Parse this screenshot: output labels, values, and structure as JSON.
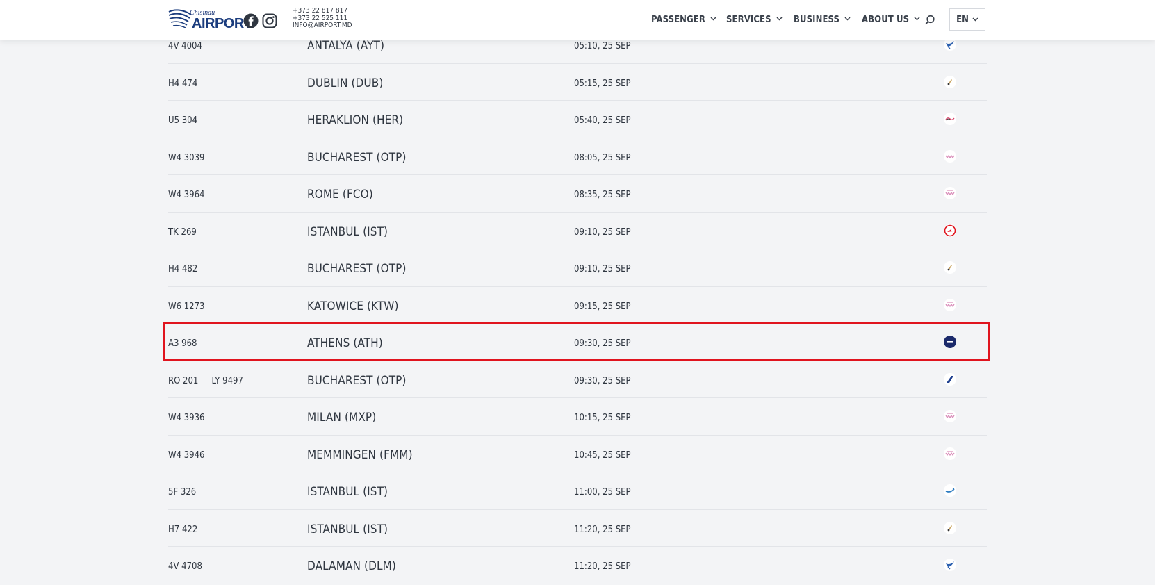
{
  "header": {
    "logo_small": "Chisinau",
    "logo_big": "AIRPORT",
    "phone1": "+373 22 817 817",
    "phone2": "+373 22 525 111",
    "email": "INFO@AIRPORT.MD",
    "nav": {
      "passenger": "PASSENGER",
      "services": "SERVICES",
      "business": "BUSINESS",
      "about": "ABOUT US"
    },
    "lang": "EN"
  },
  "departures": [
    {
      "flight": "4V 4004",
      "destination": "ANTALYA (AYT)",
      "time": "05:10, 25 SEP",
      "airline_icon": "bird-logo",
      "color": "#2a5fb0"
    },
    {
      "flight": "H4 474",
      "destination": "DUBLIN (DUB)",
      "time": "05:15, 25 SEP",
      "airline_icon": "hisky-logo",
      "color": "#c8a15a"
    },
    {
      "flight": "U5 304",
      "destination": "HERAKLION (HER)",
      "time": "05:40, 25 SEP",
      "airline_icon": "skyup-logo",
      "color": "#d9446b"
    },
    {
      "flight": "W4 3039",
      "destination": "BUCHAREST (OTP)",
      "time": "08:05, 25 SEP",
      "airline_icon": "wizz-logo",
      "color": "#d98ab8"
    },
    {
      "flight": "W4 3964",
      "destination": "ROME (FCO)",
      "time": "08:35, 25 SEP",
      "airline_icon": "wizz-logo",
      "color": "#d98ab8"
    },
    {
      "flight": "TK 269",
      "destination": "ISTANBUL (IST)",
      "time": "09:10, 25 SEP",
      "airline_icon": "turkish-airlines-logo",
      "color": "#e0141e"
    },
    {
      "flight": "H4 482",
      "destination": "BUCHAREST (OTP)",
      "time": "09:10, 25 SEP",
      "airline_icon": "hisky-logo",
      "color": "#c8a15a"
    },
    {
      "flight": "W6 1273",
      "destination": "KATOWICE (KTW)",
      "time": "09:15, 25 SEP",
      "airline_icon": "wizz-logo",
      "color": "#d98ab8"
    },
    {
      "flight": "A3 968",
      "destination": "ATHENS (ATH)",
      "time": "09:30, 25 SEP",
      "airline_icon": "aegean-logo",
      "color": "#1b2a6b"
    },
    {
      "flight": "RO 201 — LY 9497",
      "destination": "BUCHAREST (OTP)",
      "time": "09:30, 25 SEP",
      "airline_icon": "tarom-logo",
      "color": "#1e3f8f"
    },
    {
      "flight": "W4 3936",
      "destination": "MILAN (MXP)",
      "time": "10:15, 25 SEP",
      "airline_icon": "wizz-logo",
      "color": "#d98ab8"
    },
    {
      "flight": "W4 3946",
      "destination": "MEMMINGEN (FMM)",
      "time": "10:45, 25 SEP",
      "airline_icon": "wizz-logo",
      "color": "#d98ab8"
    },
    {
      "flight": "5F 326",
      "destination": "ISTANBUL (IST)",
      "time": "11:00, 25 SEP",
      "airline_icon": "flyone-logo",
      "color": "#2a7ac0"
    },
    {
      "flight": "H7 422",
      "destination": "ISTANBUL (IST)",
      "time": "11:20, 25 SEP",
      "airline_icon": "hisky-logo",
      "color": "#c8a15a"
    },
    {
      "flight": "4V 4708",
      "destination": "DALAMAN (DLM)",
      "time": "11:20, 25 SEP",
      "airline_icon": "bird-logo",
      "color": "#2a5fb0"
    }
  ],
  "highlight_color": "#e0141e"
}
